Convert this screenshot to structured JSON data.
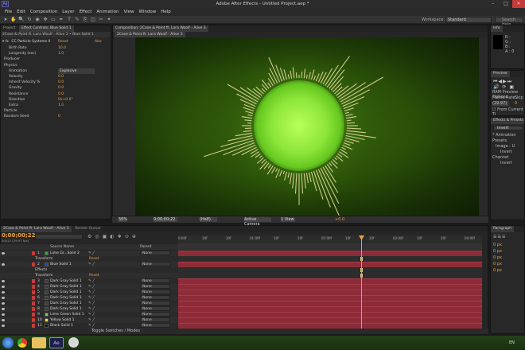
{
  "window": {
    "title": "Adobe After Effects - Untitled Project.aep *",
    "app_icon": "Ae",
    "min": "–",
    "max": "□",
    "close": "✕"
  },
  "menu": [
    "File",
    "Edit",
    "Composition",
    "Layer",
    "Effect",
    "Animation",
    "View",
    "Window",
    "Help"
  ],
  "workspace": {
    "label": "Workspace:",
    "value": "Standard",
    "search_placeholder": "Search Help"
  },
  "tools": [
    "selection-icon",
    "hand-icon",
    "zoom-icon",
    "rotate-icon",
    "camera-icon",
    "pan-behind-icon",
    "rectangle-icon",
    "pen-icon",
    "type-icon",
    "brush-icon",
    "clone-icon",
    "eraser-icon",
    "roto-icon",
    "puppet-icon"
  ],
  "project_panel": {
    "tabs": [
      "Project",
      "Effect Controls: Blue Solid 1"
    ],
    "subtitle": "2Case & Point ft. Lara Woolf - Alive 3 • Blue Solid 1",
    "effect": {
      "name": "CC Particle Systems II",
      "reset": "Reset",
      "about": "Abo"
    },
    "params": [
      {
        "name": "Birth Rate",
        "value": "10.0"
      },
      {
        "name": "Longevity (sec)",
        "value": "1.0"
      },
      {
        "name": "Producer",
        "value": ""
      },
      {
        "name": "Physics",
        "value": ""
      },
      {
        "name": "Animation",
        "value": "Explosive"
      },
      {
        "name": "Velocity",
        "value": "0.0"
      },
      {
        "name": "Inherit Velocity %",
        "value": "0.0"
      },
      {
        "name": "Gravity",
        "value": "0.0"
      },
      {
        "name": "Resistance",
        "value": "0.0"
      },
      {
        "name": "Direction",
        "value": "0x+0.0°"
      },
      {
        "name": "Extra",
        "value": "1.0"
      },
      {
        "name": "Particle",
        "value": ""
      },
      {
        "name": "Random Seed",
        "value": "0"
      }
    ]
  },
  "composition": {
    "tab": "Composition: 2Case & Point ft. Lara Woolf - Alive 3",
    "subtab": "2Case & Point ft. Lara Woolf - Alive 3",
    "footer": {
      "zoom": "50%",
      "timecode": "0;00;00;22",
      "quality": "(Half)",
      "camera": "Active Camera",
      "views": "1 View",
      "exposure": "+0.0"
    }
  },
  "info_panel": {
    "tab": "Info",
    "r": "R :",
    "g": "G :",
    "b": "B :",
    "a": "A : 0"
  },
  "preview_panel": {
    "tab": "Preview",
    "ram": "RAM Preview Options",
    "frame_rate_label": "Frame Rate",
    "skip_label": "Skip",
    "frame_rate": "(29.97)",
    "skip": "0",
    "from_current": "From Current Ti"
  },
  "effects_panel": {
    "tab": "Effects & Presets",
    "search": "invert",
    "items": [
      "* Animation Presets",
      "Image - U",
      "Invert",
      "Channel",
      "Invert"
    ]
  },
  "paragraph_panel": {
    "tab": "Paragraph",
    "vals": [
      "0 px",
      "0 px",
      "0 px",
      "0 px",
      "0 px"
    ]
  },
  "timeline": {
    "tabs": [
      "2Case & Point ft. Lara Woolf - Alive 3",
      "Render Queue"
    ],
    "timecode": "0;00;00;22",
    "fps": "00022 (29.97 fps)",
    "columns": {
      "source": "Source Name",
      "parent": "Parent"
    },
    "ruler": [
      "0:00f",
      "10f",
      "20f",
      "01:00f",
      "10f",
      "20f",
      "02:00f",
      "10f",
      "20f",
      "03:00f",
      "10f",
      "20f",
      "04:00f"
    ],
    "toggle": "Toggle Switches / Modes",
    "layers": [
      {
        "num": "1",
        "name": "Lime Gr...Solid 2",
        "color": "#3aa83a",
        "parent": "None",
        "kind": "layer"
      },
      {
        "num": "",
        "name": "Transform",
        "color": "",
        "parent": "Reset",
        "kind": "sub"
      },
      {
        "num": "2",
        "name": "Blue Solid 1",
        "color": "#2a3ad8",
        "parent": "None",
        "kind": "layer"
      },
      {
        "num": "",
        "name": "Effects",
        "color": "",
        "parent": "",
        "kind": "sub"
      },
      {
        "num": "",
        "name": "Transform",
        "color": "",
        "parent": "Reset",
        "kind": "sub"
      },
      {
        "num": "3",
        "name": "Dark Gray Solid 1",
        "color": "#3a3a3a",
        "parent": "None",
        "kind": "layer"
      },
      {
        "num": "4",
        "name": "Dark Gray Solid 1",
        "color": "#3a3a3a",
        "parent": "None",
        "kind": "layer"
      },
      {
        "num": "5",
        "name": "Dark Gray Solid 1",
        "color": "#3a3a3a",
        "parent": "None",
        "kind": "layer"
      },
      {
        "num": "6",
        "name": "Dark Gray Solid 1",
        "color": "#3a3a3a",
        "parent": "None",
        "kind": "layer"
      },
      {
        "num": "7",
        "name": "Dark Gray Solid 1",
        "color": "#3a3a3a",
        "parent": "None",
        "kind": "layer"
      },
      {
        "num": "8",
        "name": "Dark Gray Solid 1",
        "color": "#3a3a3a",
        "parent": "None",
        "kind": "layer"
      },
      {
        "num": "9",
        "name": "Lime Green Solid 1",
        "color": "#6ad83a",
        "parent": "None",
        "kind": "layer"
      },
      {
        "num": "10",
        "name": "Yellow Solid 1",
        "color": "#e8e030",
        "parent": "None",
        "kind": "layer"
      },
      {
        "num": "11",
        "name": "Black Solid 1",
        "color": "#111111",
        "parent": "None",
        "kind": "layer"
      }
    ]
  },
  "taskbar": {
    "apps": [
      "chrome-icon",
      "folder-icon",
      "after-effects-icon",
      "settings-icon"
    ],
    "ae_label": "Ae",
    "tray": "EN"
  }
}
